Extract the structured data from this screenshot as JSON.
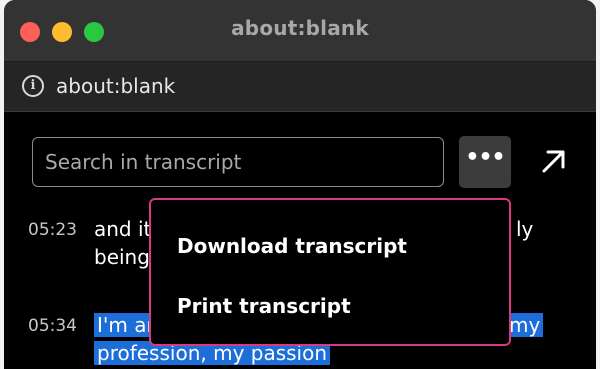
{
  "window": {
    "title": "about:blank"
  },
  "address_bar": {
    "url": "about:blank",
    "icon": "info-icon"
  },
  "transcript_panel": {
    "search": {
      "placeholder": "Search in transcript",
      "value": ""
    },
    "more_button_label": "•••",
    "expand_icon": "arrow-up-right-icon",
    "entries": [
      {
        "time": "05:23",
        "line1_left": "and it",
        "line1_right": "ly",
        "line2": "being"
      },
      {
        "time": "05:34",
        "line1_left": "I'm an",
        "line1_right": "my",
        "line2": "profession, my passion"
      }
    ]
  },
  "menu": {
    "items": [
      {
        "label": "Download transcript"
      },
      {
        "label": "Print transcript"
      }
    ],
    "border_color": "#d63a7f"
  },
  "colors": {
    "highlight": "#1d6ed8",
    "traffic_close": "#fe5f57",
    "traffic_min": "#febc2e",
    "traffic_max": "#28c840"
  }
}
